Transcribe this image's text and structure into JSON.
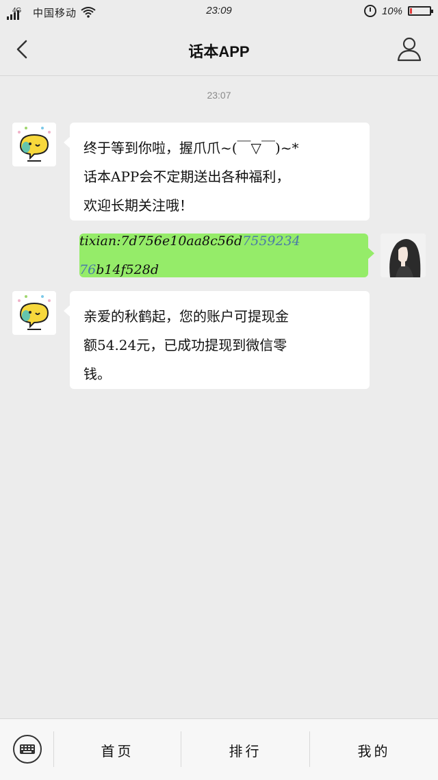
{
  "status_bar": {
    "network": "4G",
    "carrier": "中国移动",
    "time": "23:09",
    "battery": "10%",
    "battery_level": 0.1,
    "colors": {
      "battery_low": "#e23b3b"
    }
  },
  "nav": {
    "back_icon": "chevron-left-icon",
    "title": "话本APP",
    "profile_icon": "person-icon"
  },
  "chat": {
    "timestamp": "23:07",
    "messages": [
      {
        "side": "left",
        "lines": [
          "终于等到你啦，握爪爪~(￣▽￣)~*",
          "话本APP会不定期送出各种福利，",
          "欢迎长期关注哦！"
        ]
      },
      {
        "side": "right",
        "text_start": "tixian:7d756e10aa8c56d",
        "text_highlight": "7559234 76",
        "text_end": "b14f528d"
      },
      {
        "side": "left",
        "lines": [
          "亲爱的秋鹤起，您的账户可提现金",
          "额54.24元，已成功提现到微信零",
          "钱。"
        ]
      }
    ]
  },
  "bottom_bar": {
    "keyboard_icon": "keyboard-icon",
    "items": [
      {
        "label": "首页"
      },
      {
        "label": "排行"
      },
      {
        "label": "我的"
      }
    ]
  },
  "colors": {
    "background": "#ececec",
    "outgoing_bubble": "#95ec69",
    "incoming_bubble": "#ffffff"
  }
}
